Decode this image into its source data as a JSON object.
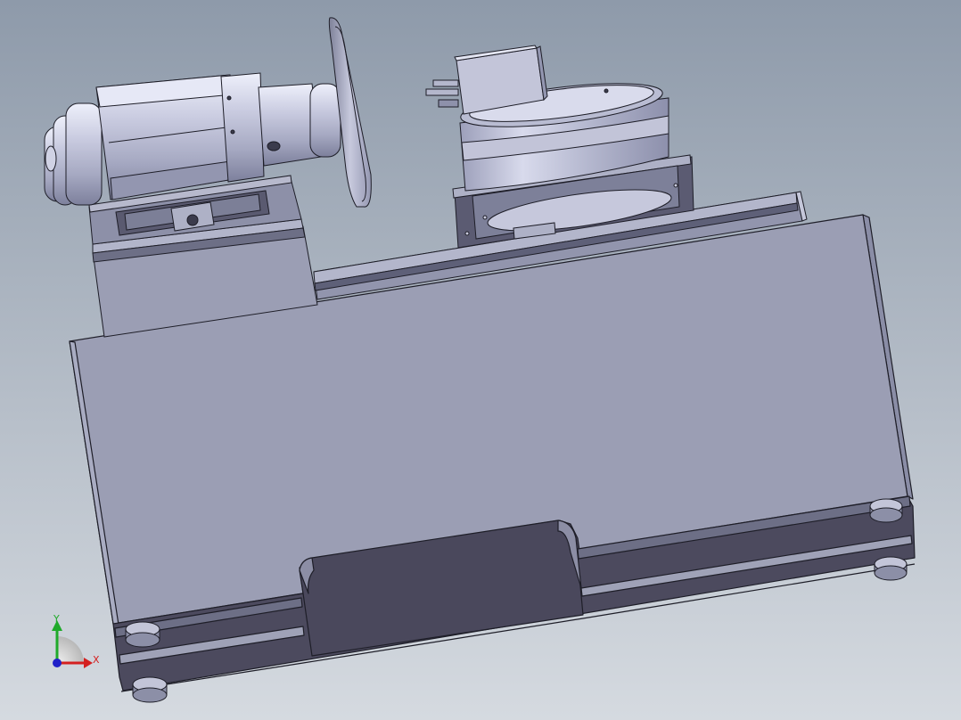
{
  "viewport": {
    "background_top": "#8e9aaa",
    "background_bottom": "#d5dae0"
  },
  "colors": {
    "body_face": "#9b9eb4",
    "body_light": "#a6a9be",
    "body_dark": "#4c4a5e",
    "body_mid": "#7f8199",
    "edge": "#1e1e28",
    "cylinder_light": "#d6d8ec",
    "cylinder_mid": "#aeb1ca",
    "cylinder_dark": "#6f7290"
  },
  "triad": {
    "x_label": "X",
    "y_label": "Y",
    "x_color": "#d42020",
    "y_color": "#1faa2a",
    "z_color": "#2020c8"
  }
}
